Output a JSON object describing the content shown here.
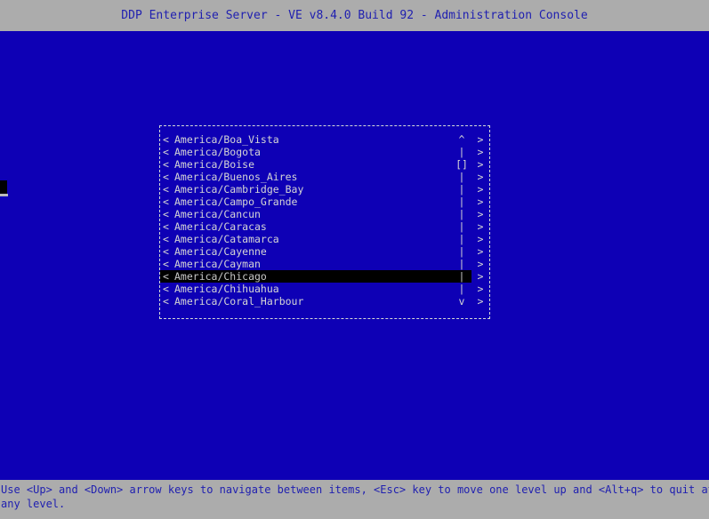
{
  "window": {
    "title": "DDP Enterprise Server - VE v8.4.0 Build 92 - Administration Console",
    "background_color": "#0e00b5",
    "chrome_color": "#acacac",
    "chrome_text_color": "#2020b0",
    "terminal_text_color": "#d5d5d5",
    "selection_background_color": "#000000"
  },
  "dialog": {
    "name": "timezone-selection-list",
    "border_style": "dashed",
    "left_marker": "<",
    "right_marker": ">",
    "items": [
      {
        "label": "America/Boa_Vista",
        "scroll": "^",
        "selected": false
      },
      {
        "label": "America/Bogota",
        "scroll": "|",
        "selected": false
      },
      {
        "label": "America/Boise",
        "scroll": "[]",
        "selected": false
      },
      {
        "label": "America/Buenos_Aires",
        "scroll": "|",
        "selected": false
      },
      {
        "label": "America/Cambridge_Bay",
        "scroll": "|",
        "selected": false
      },
      {
        "label": "America/Campo_Grande",
        "scroll": "|",
        "selected": false
      },
      {
        "label": "America/Cancun",
        "scroll": "|",
        "selected": false
      },
      {
        "label": "America/Caracas",
        "scroll": "|",
        "selected": false
      },
      {
        "label": "America/Catamarca",
        "scroll": "|",
        "selected": false
      },
      {
        "label": "America/Cayenne",
        "scroll": "|",
        "selected": false
      },
      {
        "label": "America/Cayman",
        "scroll": "|",
        "selected": false
      },
      {
        "label": "America/Chicago",
        "scroll": "|",
        "selected": true
      },
      {
        "label": "America/Chihuahua",
        "scroll": "|",
        "selected": false
      },
      {
        "label": "America/Coral_Harbour",
        "scroll": "v",
        "selected": false
      }
    ]
  },
  "status_bar": {
    "line1": "Use <Up> and <Down> arrow keys to navigate between items, <Esc> key to move one level up and <Alt+q> to quit at",
    "line2": "any level."
  }
}
